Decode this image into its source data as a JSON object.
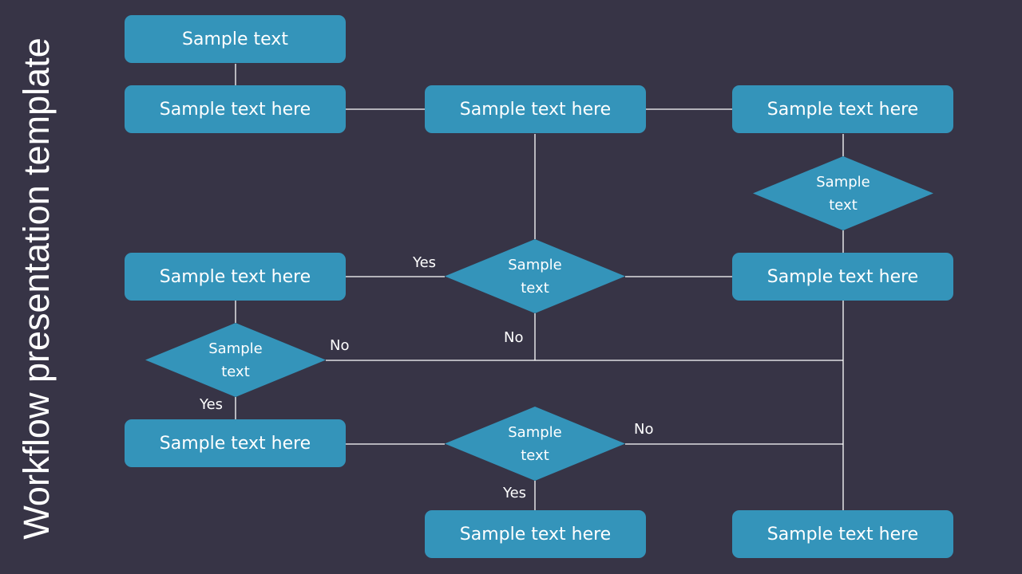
{
  "title": "Workflow presentation template",
  "colors": {
    "background": "#373446",
    "shape": "#3494BA",
    "line": "#ffffff",
    "text": "#ffffff"
  },
  "boxes": [
    {
      "label": "Sample text"
    },
    {
      "label": "Sample text here"
    },
    {
      "label": "Sample text here"
    },
    {
      "label": "Sample text here"
    },
    {
      "label": "Sample text here"
    },
    {
      "label": "Sample text here"
    },
    {
      "label": "Sample text here"
    },
    {
      "label": "Sample text here"
    },
    {
      "label": "Sample text here"
    }
  ],
  "decisions": [
    {
      "line1": "Sample",
      "line2": "text"
    },
    {
      "line1": "Sample",
      "line2": "text"
    },
    {
      "line1": "Sample",
      "line2": "text"
    },
    {
      "line1": "Sample",
      "line2": "text"
    }
  ],
  "labels": {
    "yes_top": "Yes",
    "no_center": "No",
    "no_left": "No",
    "yes_left": "Yes",
    "no_bottom": "No",
    "yes_bottom": "Yes"
  }
}
